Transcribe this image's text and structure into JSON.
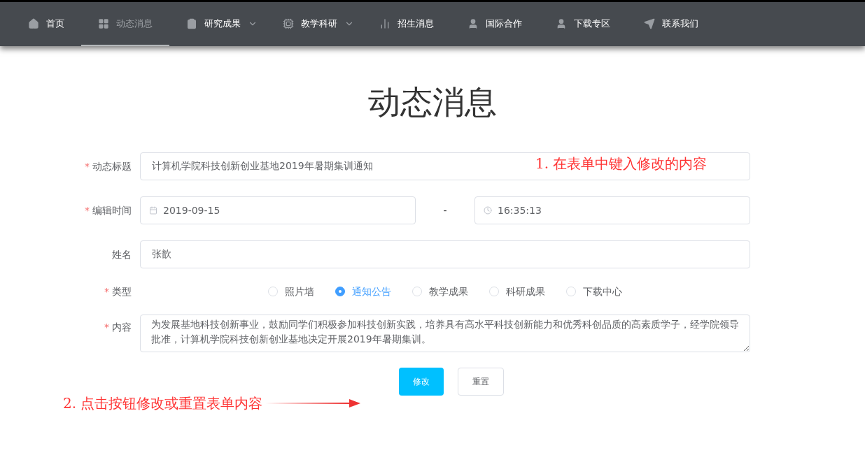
{
  "nav": {
    "items": [
      {
        "label": "首页",
        "selected": false,
        "dropdown": false
      },
      {
        "label": "动态消息",
        "selected": true,
        "dropdown": false
      },
      {
        "label": "研究成果",
        "selected": false,
        "dropdown": true
      },
      {
        "label": "教学科研",
        "selected": false,
        "dropdown": true
      },
      {
        "label": "招生消息",
        "selected": false,
        "dropdown": false
      },
      {
        "label": "国际合作",
        "selected": false,
        "dropdown": false
      },
      {
        "label": "下载专区",
        "selected": false,
        "dropdown": false
      },
      {
        "label": "联系我们",
        "selected": false,
        "dropdown": false
      }
    ]
  },
  "page_title": "动态消息",
  "form": {
    "rows": [
      {
        "kind": "text",
        "label": "动态标题",
        "required_mark": "*",
        "value": "计算机学院科技创新创业基地2019年暑期集训通知"
      },
      {
        "kind": "datetime",
        "label": "编辑时间",
        "required_mark": "*",
        "date": "2019-09-15",
        "separator": "-",
        "time": "16:35:13"
      },
      {
        "kind": "text",
        "label": "姓名",
        "value": "张歆"
      },
      {
        "kind": "radio",
        "label": "类型",
        "required_mark": "*",
        "options": [
          {
            "label": "照片墙",
            "selected": false
          },
          {
            "label": "通知公告",
            "selected": true
          },
          {
            "label": "教学成果",
            "selected": false
          },
          {
            "label": "科研成果",
            "selected": false
          },
          {
            "label": "下载中心",
            "selected": false
          }
        ]
      },
      {
        "kind": "textarea",
        "label": "内容",
        "required_mark": "*",
        "value": "为发展基地科技创新事业，鼓励同学们积极参加科技创新实践，培养具有高水平科技创新能力和优秀科创品质的高素质学子，经学院领导批准，计算机学院科技创新创业基地决定开展2019年暑期集训。"
      }
    ],
    "buttons": [
      {
        "label": "修改",
        "kind": "primary"
      },
      {
        "label": "重置",
        "kind": "default"
      }
    ]
  },
  "annotations": [
    {
      "text": "1.  在表单中键入修改的内容"
    },
    {
      "text": "2.  点击按钮修改或重置表单内容"
    }
  ]
}
